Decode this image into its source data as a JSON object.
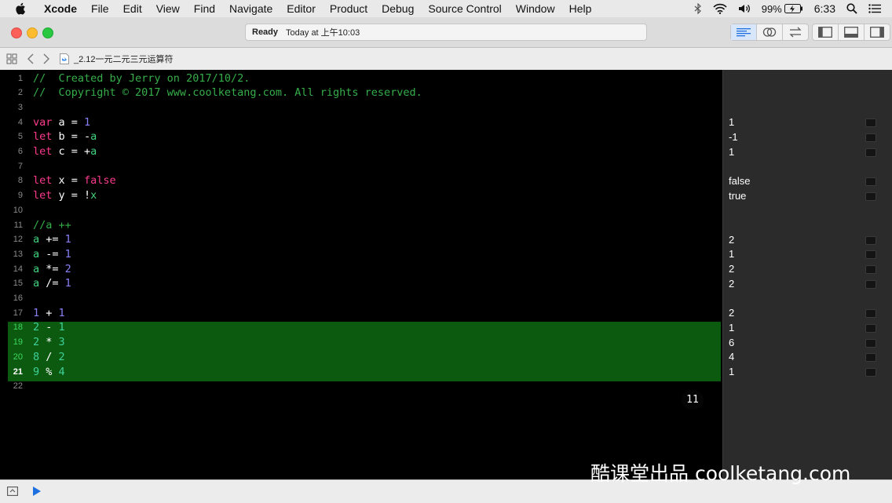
{
  "menubar": {
    "app": "Xcode",
    "items": [
      "File",
      "Edit",
      "View",
      "Find",
      "Navigate",
      "Editor",
      "Product",
      "Debug",
      "Source Control",
      "Window",
      "Help"
    ],
    "battery": "99%",
    "time": "6:33"
  },
  "toolbar": {
    "status_ready": "Ready",
    "status_time": "Today at 上午10:03"
  },
  "jumpbar": {
    "filename": "_2.12一元二元三元运算符"
  },
  "editor": {
    "lines": [
      {
        "n": "1",
        "tokens": [
          {
            "t": "//  Created by Jerry on 2017/10/2.",
            "c": "cm"
          }
        ]
      },
      {
        "n": "2",
        "tokens": [
          {
            "t": "//  Copyright © 2017 www.coolketang.com. All rights reserved.",
            "c": "cm"
          }
        ]
      },
      {
        "n": "3",
        "tokens": []
      },
      {
        "n": "4",
        "tokens": [
          {
            "t": "var",
            "c": "kw"
          },
          {
            "t": " a = ",
            "c": ""
          },
          {
            "t": "1",
            "c": "num"
          }
        ]
      },
      {
        "n": "5",
        "tokens": [
          {
            "t": "let",
            "c": "kw"
          },
          {
            "t": " b = -",
            "c": ""
          },
          {
            "t": "a",
            "c": "var"
          }
        ]
      },
      {
        "n": "6",
        "tokens": [
          {
            "t": "let",
            "c": "kw"
          },
          {
            "t": " c = +",
            "c": ""
          },
          {
            "t": "a",
            "c": "var"
          }
        ]
      },
      {
        "n": "7",
        "tokens": []
      },
      {
        "n": "8",
        "tokens": [
          {
            "t": "let",
            "c": "kw"
          },
          {
            "t": " x = ",
            "c": ""
          },
          {
            "t": "false",
            "c": "kw"
          }
        ]
      },
      {
        "n": "9",
        "tokens": [
          {
            "t": "let",
            "c": "kw"
          },
          {
            "t": " y = !",
            "c": ""
          },
          {
            "t": "x",
            "c": "var"
          }
        ]
      },
      {
        "n": "10",
        "tokens": []
      },
      {
        "n": "11",
        "tokens": [
          {
            "t": "//a ++",
            "c": "cm"
          }
        ]
      },
      {
        "n": "12",
        "tokens": [
          {
            "t": "a",
            "c": "var"
          },
          {
            "t": " += ",
            "c": ""
          },
          {
            "t": "1",
            "c": "num"
          }
        ]
      },
      {
        "n": "13",
        "tokens": [
          {
            "t": "a",
            "c": "var"
          },
          {
            "t": " -= ",
            "c": ""
          },
          {
            "t": "1",
            "c": "num"
          }
        ]
      },
      {
        "n": "14",
        "tokens": [
          {
            "t": "a",
            "c": "var"
          },
          {
            "t": " *= ",
            "c": ""
          },
          {
            "t": "2",
            "c": "num"
          }
        ]
      },
      {
        "n": "15",
        "tokens": [
          {
            "t": "a",
            "c": "var"
          },
          {
            "t": " /= ",
            "c": ""
          },
          {
            "t": "1",
            "c": "num"
          }
        ]
      },
      {
        "n": "16",
        "tokens": []
      },
      {
        "n": "17",
        "tokens": [
          {
            "t": "1",
            "c": "num"
          },
          {
            "t": " + ",
            "c": ""
          },
          {
            "t": "1",
            "c": "num"
          }
        ]
      },
      {
        "n": "18",
        "tokens": [
          {
            "t": "2",
            "c": "num"
          },
          {
            "t": " - ",
            "c": ""
          },
          {
            "t": "1",
            "c": "num"
          }
        ]
      },
      {
        "n": "19",
        "tokens": [
          {
            "t": "2",
            "c": "num"
          },
          {
            "t": " * ",
            "c": ""
          },
          {
            "t": "3",
            "c": "num"
          }
        ]
      },
      {
        "n": "20",
        "tokens": [
          {
            "t": "8",
            "c": "num"
          },
          {
            "t": " / ",
            "c": ""
          },
          {
            "t": "2",
            "c": "num"
          }
        ]
      },
      {
        "n": "21",
        "tokens": [
          {
            "t": "9",
            "c": "num"
          },
          {
            "t": " % ",
            "c": ""
          },
          {
            "t": "4",
            "c": "num"
          }
        ]
      },
      {
        "n": "22",
        "tokens": []
      }
    ],
    "selection_badge": "11"
  },
  "results": [
    {
      "n": "4",
      "v": "1"
    },
    {
      "n": "5",
      "v": "-1"
    },
    {
      "n": "6",
      "v": "1"
    },
    {
      "n": "8",
      "v": "false"
    },
    {
      "n": "9",
      "v": "true"
    },
    {
      "n": "12",
      "v": "2"
    },
    {
      "n": "13",
      "v": "1"
    },
    {
      "n": "14",
      "v": "2"
    },
    {
      "n": "15",
      "v": "2"
    },
    {
      "n": "17",
      "v": "2"
    },
    {
      "n": "18",
      "v": "1"
    },
    {
      "n": "19",
      "v": "6"
    },
    {
      "n": "20",
      "v": "4"
    },
    {
      "n": "21",
      "v": "1"
    }
  ],
  "watermark": "酷课堂出品 coolketang.com",
  "colors": {
    "keyword": "#fc3b8d",
    "number": "#8a80f5",
    "variable": "#40d27b",
    "comment": "#35ae4a",
    "selection": "#0c5a10"
  }
}
